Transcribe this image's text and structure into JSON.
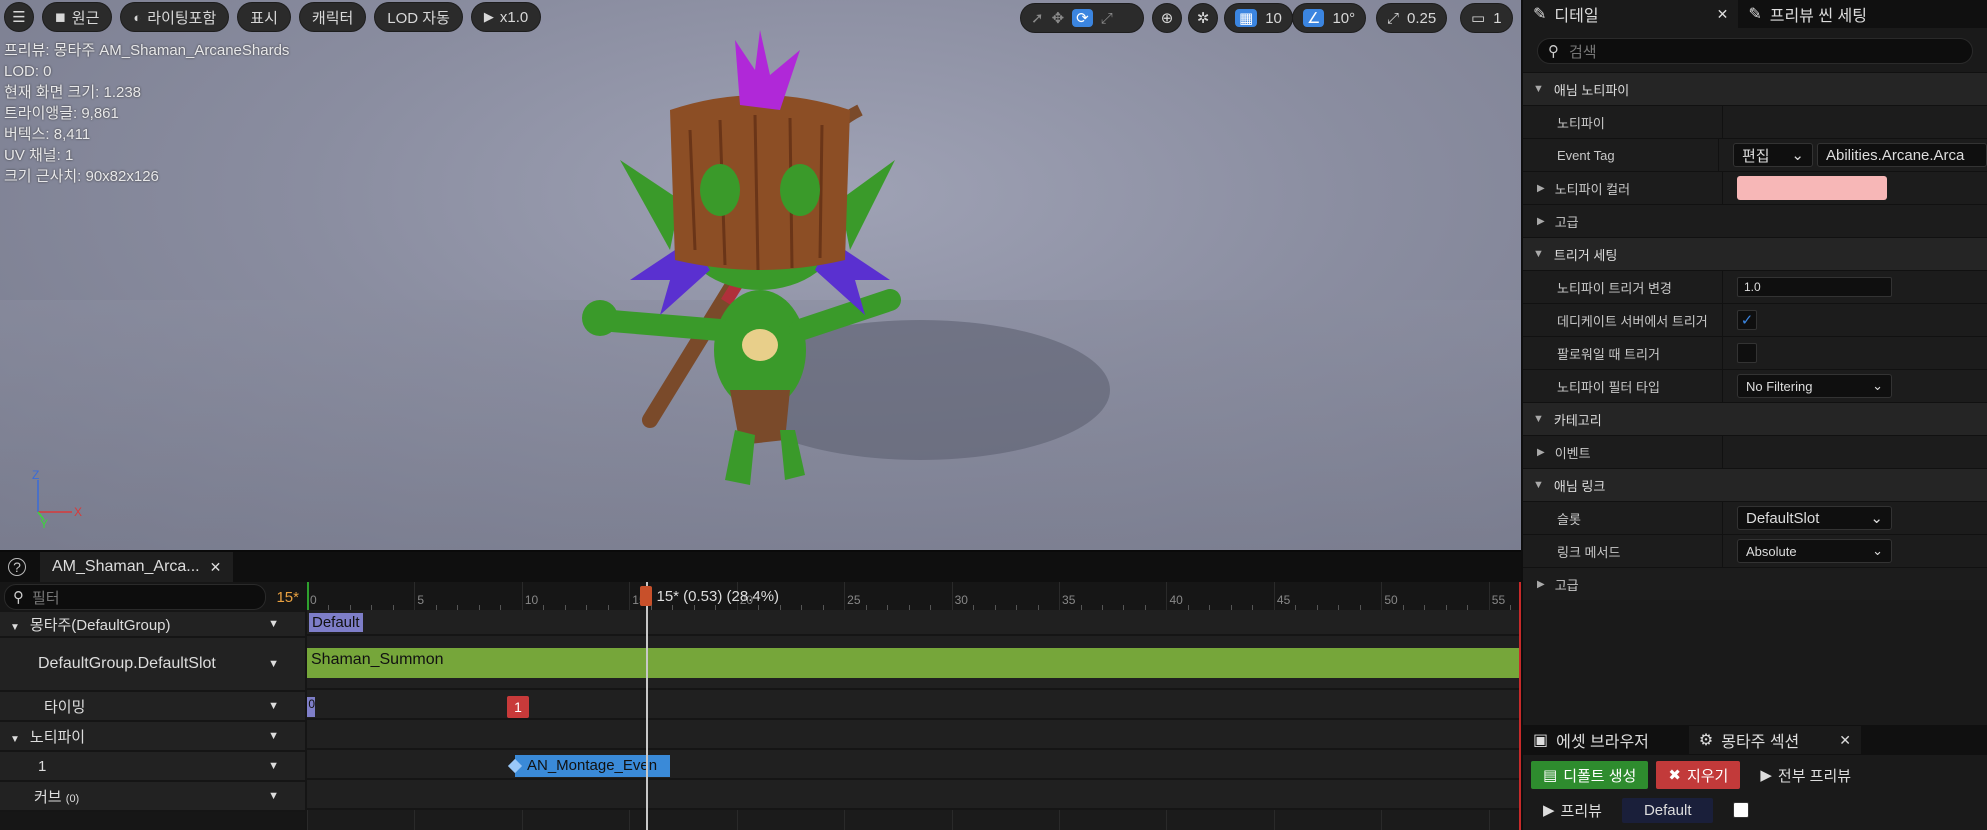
{
  "viewport": {
    "toolbar": {
      "menu_icon": "hamburger-icon",
      "perspective_label": "원근",
      "lighting_label": "라이팅포함",
      "show_label": "표시",
      "character_label": "캐릭터",
      "lod_label": "LOD 자동",
      "play_speed_label": "x1.0",
      "grid_snap_value": "10",
      "rotation_snap_value": "10°",
      "scale_snap_value": "0.25",
      "camera_speed_value": "1"
    },
    "stats": [
      "프리뷰: 몽타주 AM_Shaman_ArcaneShards",
      "LOD: 0",
      "현재 화면 크기: 1.238",
      "트라이앵글: 9,861",
      "버텍스: 8,411",
      "UV 채널: 1",
      "크기 근사치: 90x82x126"
    ],
    "axes": {
      "z": "Z",
      "y": "Y",
      "x": "X"
    }
  },
  "details": {
    "tabs": [
      {
        "label": "디테일",
        "icon": "pencil-icon"
      },
      {
        "label": "프리뷰 씬 세팅",
        "icon": "pencil-icon"
      }
    ],
    "search_placeholder": "검색",
    "sections": {
      "anim_notify": "애님 노티파이",
      "notify_label": "노티파이",
      "event_tag_label": "Event Tag",
      "edit_label": "편집",
      "event_tag_value": "Abilities.Arcane.Arca",
      "notify_color_label": "노티파이 컬러",
      "notify_color": "#f7b7b7",
      "advanced_label": "고급",
      "trigger_settings": "트리거 세팅",
      "trigger_change_label": "노티파이 트리거 변경",
      "trigger_change_value": "1.0",
      "dedicated_label": "데디케이트 서버에서 트리거",
      "follower_label": "팔로워일 때 트리거",
      "filter_type_label": "노티파이 필터 타입",
      "filter_type_value": "No Filtering",
      "category": "카테고리",
      "event_label": "이벤트",
      "anim_link": "애님 링크",
      "slot_label": "슬롯",
      "slot_value": "DefaultSlot",
      "link_method_label": "링크 메서드",
      "link_method_value": "Absolute",
      "advanced2_label": "고급"
    }
  },
  "montage_sections": {
    "tabs": [
      "에셋 브라우저",
      "몽타주 섹션"
    ],
    "create_default_label": "디폴트 생성",
    "clear_label": "지우기",
    "preview_all_label": "전부 프리뷰",
    "preview_label": "프리뷰",
    "default_section": "Default"
  },
  "timeline": {
    "tab_label": "AM_Shaman_Arca...",
    "filter_placeholder": "필터",
    "frame_badge": "15*",
    "current_label": "15* (0.53) (28.4%)",
    "ticks": [
      "0",
      "5",
      "10",
      "15",
      "20",
      "25",
      "30",
      "35",
      "40",
      "45",
      "50",
      "55"
    ],
    "rows": {
      "montage_group": "몽타주(DefaultGroup)",
      "slot": "DefaultGroup.DefaultSlot",
      "timing": "타이밍",
      "notifies": "노티파이",
      "notify_track": "1",
      "curves": "커브",
      "curves_count": "(0)"
    },
    "section_name": "Default",
    "segment_name": "Shaman_Summon",
    "timing_marker_start": "0",
    "timing_marker": "1",
    "notify_name": "AN_Montage_Even"
  }
}
